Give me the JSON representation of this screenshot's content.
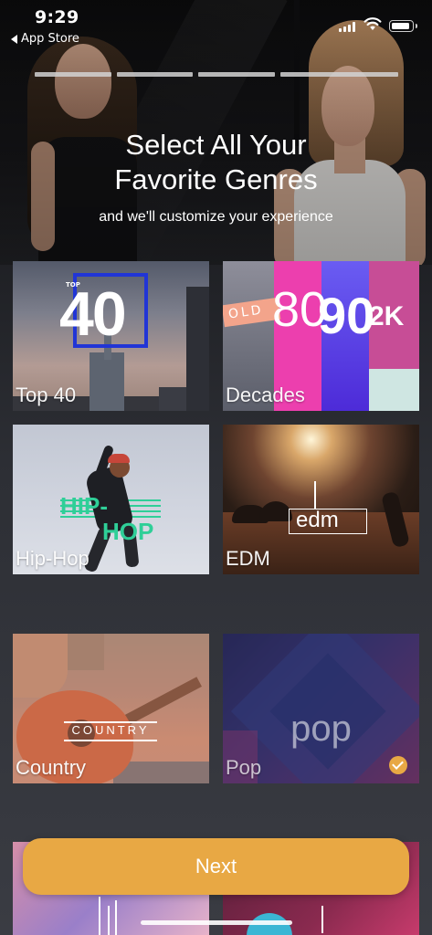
{
  "status_bar": {
    "time": "9:29",
    "back_label": "App Store"
  },
  "onboarding": {
    "progress_segments": 4,
    "headline_line1": "Select All Your",
    "headline_line2": "Favorite Genres",
    "subline": "and we'll customize your experience"
  },
  "genres": [
    {
      "label": "Top 40",
      "selected": false,
      "art_text": {
        "small": "TOP",
        "big": "40"
      }
    },
    {
      "label": "Decades",
      "selected": false,
      "art_text": {
        "old": "OLD",
        "d80": "80",
        "d90": "90",
        "d2k": "2K"
      }
    },
    {
      "label": "Hip-Hop",
      "selected": false,
      "art_text": {
        "line1": "HIP-",
        "line2": "HOP"
      }
    },
    {
      "label": "EDM",
      "selected": false,
      "art_text": {
        "word": "edm"
      }
    },
    {
      "label": "Country",
      "selected": false,
      "art_text": {
        "word": "COUNTRY"
      }
    },
    {
      "label": "Pop",
      "selected": true,
      "art_text": {
        "word": "pop"
      }
    }
  ],
  "next_button_label": "Next",
  "colors": {
    "accent": "#e8a844",
    "background": "#2b2d33"
  }
}
